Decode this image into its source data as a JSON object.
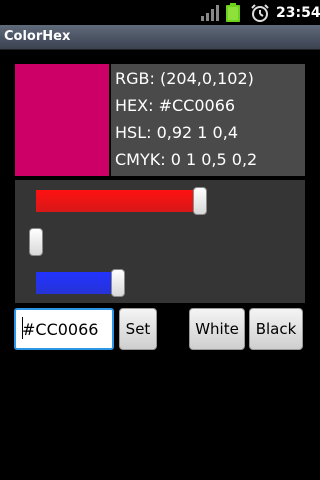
{
  "status_bar": {
    "time": "23:54"
  },
  "app": {
    "title": "ColorHex"
  },
  "color": {
    "hex_value": "#CC0066",
    "swatch_color": "#cc0066"
  },
  "info": {
    "rgb": "RGB: (204,0,102)",
    "hex": "HEX: #CC0066",
    "hsl": "HSL: 0,92 1 0,4",
    "cmyk": "CMYK: 0 1 0,5 0,2"
  },
  "sliders": {
    "red": {
      "value": 204,
      "max": 255,
      "color": "#ff1111"
    },
    "green": {
      "value": 0,
      "max": 255,
      "color": "#00cc00"
    },
    "blue": {
      "value": 102,
      "max": 255,
      "color": "#2233ff"
    }
  },
  "controls": {
    "set_label": "Set",
    "white_label": "White",
    "black_label": "Black"
  }
}
